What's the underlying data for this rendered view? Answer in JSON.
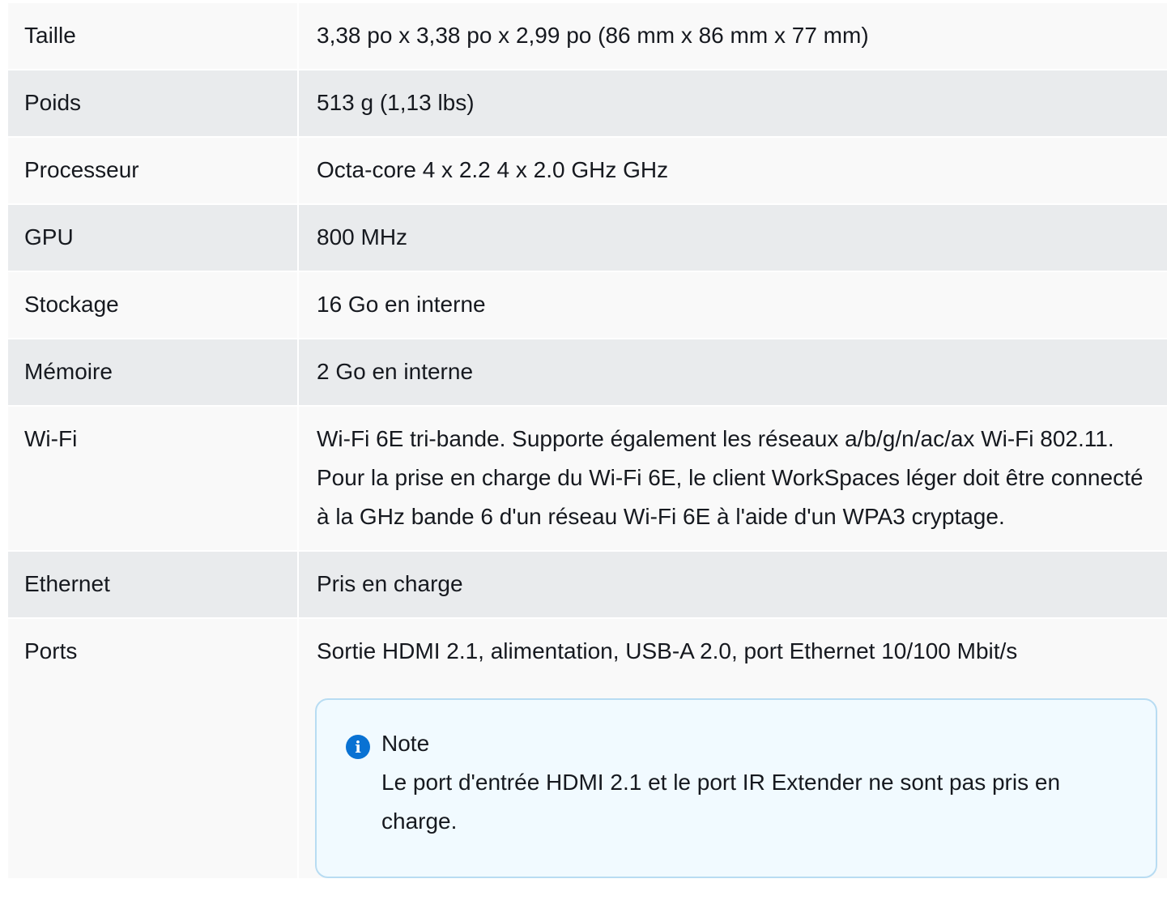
{
  "specs": {
    "rows": [
      {
        "label": "Taille",
        "value": "3,38 po x 3,38 po x 2,99 po (86 mm x 86 mm x 77 mm)"
      },
      {
        "label": "Poids",
        "value": "513 g (1,13 lbs)"
      },
      {
        "label": "Processeur",
        "value": "Octa-core 4 x 2.2 4 x 2.0 GHz GHz"
      },
      {
        "label": "GPU",
        "value": "800 MHz"
      },
      {
        "label": "Stockage",
        "value": "16 Go en interne"
      },
      {
        "label": "Mémoire",
        "value": "2 Go en interne"
      },
      {
        "label": "Wi-Fi",
        "value": "Wi-Fi 6E tri-bande. Supporte également les réseaux a/b/g/n/ac/ax Wi-Fi 802.11. Pour la prise en charge du Wi-Fi 6E, le client WorkSpaces léger doit être connecté à la GHz bande 6 d'un réseau Wi-Fi 6E à l'aide d'un WPA3 cryptage."
      },
      {
        "label": "Ethernet",
        "value": "Pris en charge"
      },
      {
        "label": "Ports",
        "value": "Sortie HDMI 2.1, alimentation, USB-A 2.0, port Ethernet 10/100 Mbit/s"
      }
    ]
  },
  "note": {
    "icon": "info-icon",
    "icon_glyph": "i",
    "title": "Note",
    "body": "Le port d'entrée HDMI 2.1 et le port IR Extender ne sont pas pris en charge."
  },
  "colors": {
    "row_light": "#f9f9f9",
    "row_dark": "#e9ebed",
    "note_background": "#f1faff",
    "note_border": "#b8dcf2",
    "info_icon": "#0972d3",
    "text": "#16191f"
  }
}
